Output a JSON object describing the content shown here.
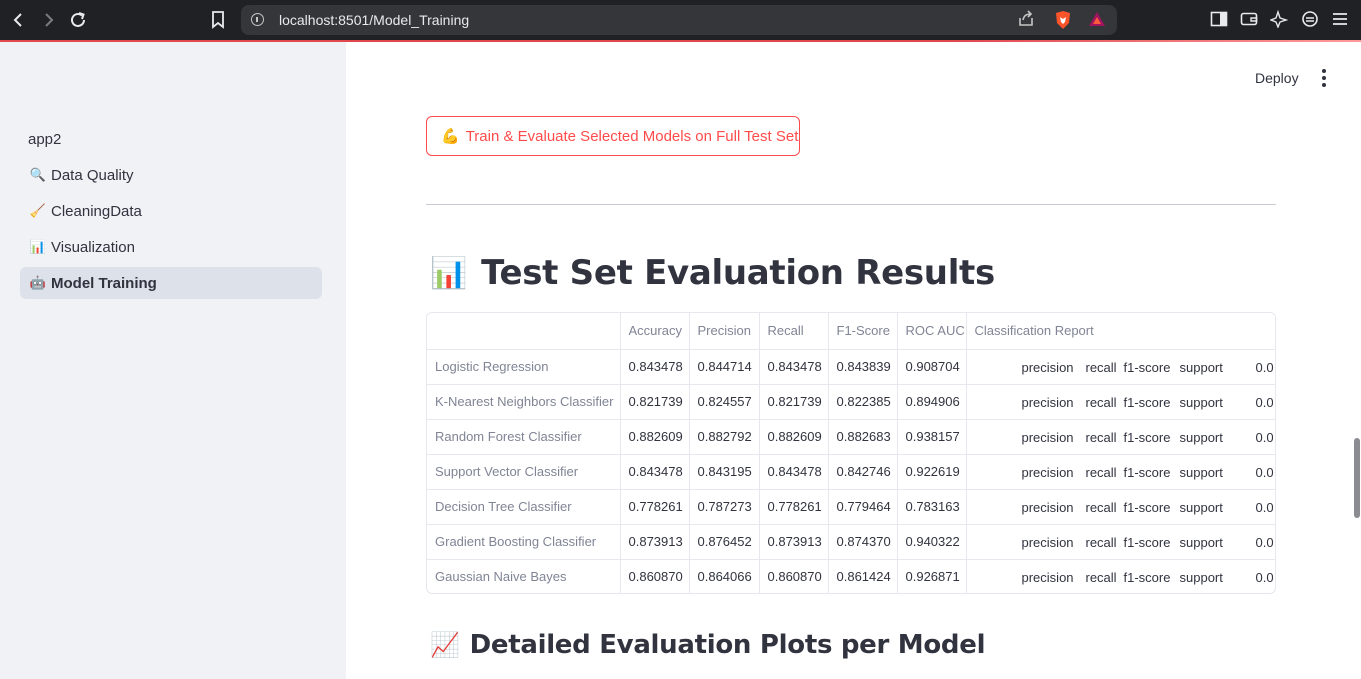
{
  "browser": {
    "url": "localhost:8501/Model_Training"
  },
  "sidebar": {
    "app_title": "app2",
    "items": [
      {
        "icon": "🔍",
        "label": "Data Quality"
      },
      {
        "icon": "🧹",
        "label": "CleaningData"
      },
      {
        "icon": "📊",
        "label": "Visualization"
      },
      {
        "icon": "🤖",
        "label": "Model Training"
      }
    ]
  },
  "header": {
    "deploy_label": "Deploy"
  },
  "main": {
    "train_button": {
      "icon": "💪",
      "label": "Train & Evaluate Selected Models on Full Test Set"
    },
    "results_title": {
      "icon": "📊",
      "text": "Test Set Evaluation Results"
    },
    "plots_title": {
      "icon": "📈",
      "text": "Detailed Evaluation Plots per Model"
    },
    "table": {
      "columns": [
        "",
        "Accuracy",
        "Precision",
        "Recall",
        "F1-Score",
        "ROC AUC",
        "Classification Report"
      ],
      "report_cells": [
        "precision",
        "recall",
        "f1-score",
        "support",
        "0.0"
      ],
      "rows": [
        {
          "model": "Logistic Regression",
          "accuracy": "0.843478",
          "precision": "0.844714",
          "recall": "0.843478",
          "f1": "0.843839",
          "roc_auc": "0.908704"
        },
        {
          "model": "K-Nearest Neighbors Classifier",
          "accuracy": "0.821739",
          "precision": "0.824557",
          "recall": "0.821739",
          "f1": "0.822385",
          "roc_auc": "0.894906"
        },
        {
          "model": "Random Forest Classifier",
          "accuracy": "0.882609",
          "precision": "0.882792",
          "recall": "0.882609",
          "f1": "0.882683",
          "roc_auc": "0.938157"
        },
        {
          "model": "Support Vector Classifier",
          "accuracy": "0.843478",
          "precision": "0.843195",
          "recall": "0.843478",
          "f1": "0.842746",
          "roc_auc": "0.922619"
        },
        {
          "model": "Decision Tree Classifier",
          "accuracy": "0.778261",
          "precision": "0.787273",
          "recall": "0.778261",
          "f1": "0.779464",
          "roc_auc": "0.783163"
        },
        {
          "model": "Gradient Boosting Classifier",
          "accuracy": "0.873913",
          "precision": "0.876452",
          "recall": "0.873913",
          "f1": "0.874370",
          "roc_auc": "0.940322"
        },
        {
          "model": "Gaussian Naive Bayes",
          "accuracy": "0.860870",
          "precision": "0.864066",
          "recall": "0.860870",
          "f1": "0.861424",
          "roc_auc": "0.926871"
        }
      ]
    }
  },
  "colors": {
    "accent": "#ff4b4b",
    "sidebar_bg": "#f0f2f6",
    "text": "#31333f"
  }
}
